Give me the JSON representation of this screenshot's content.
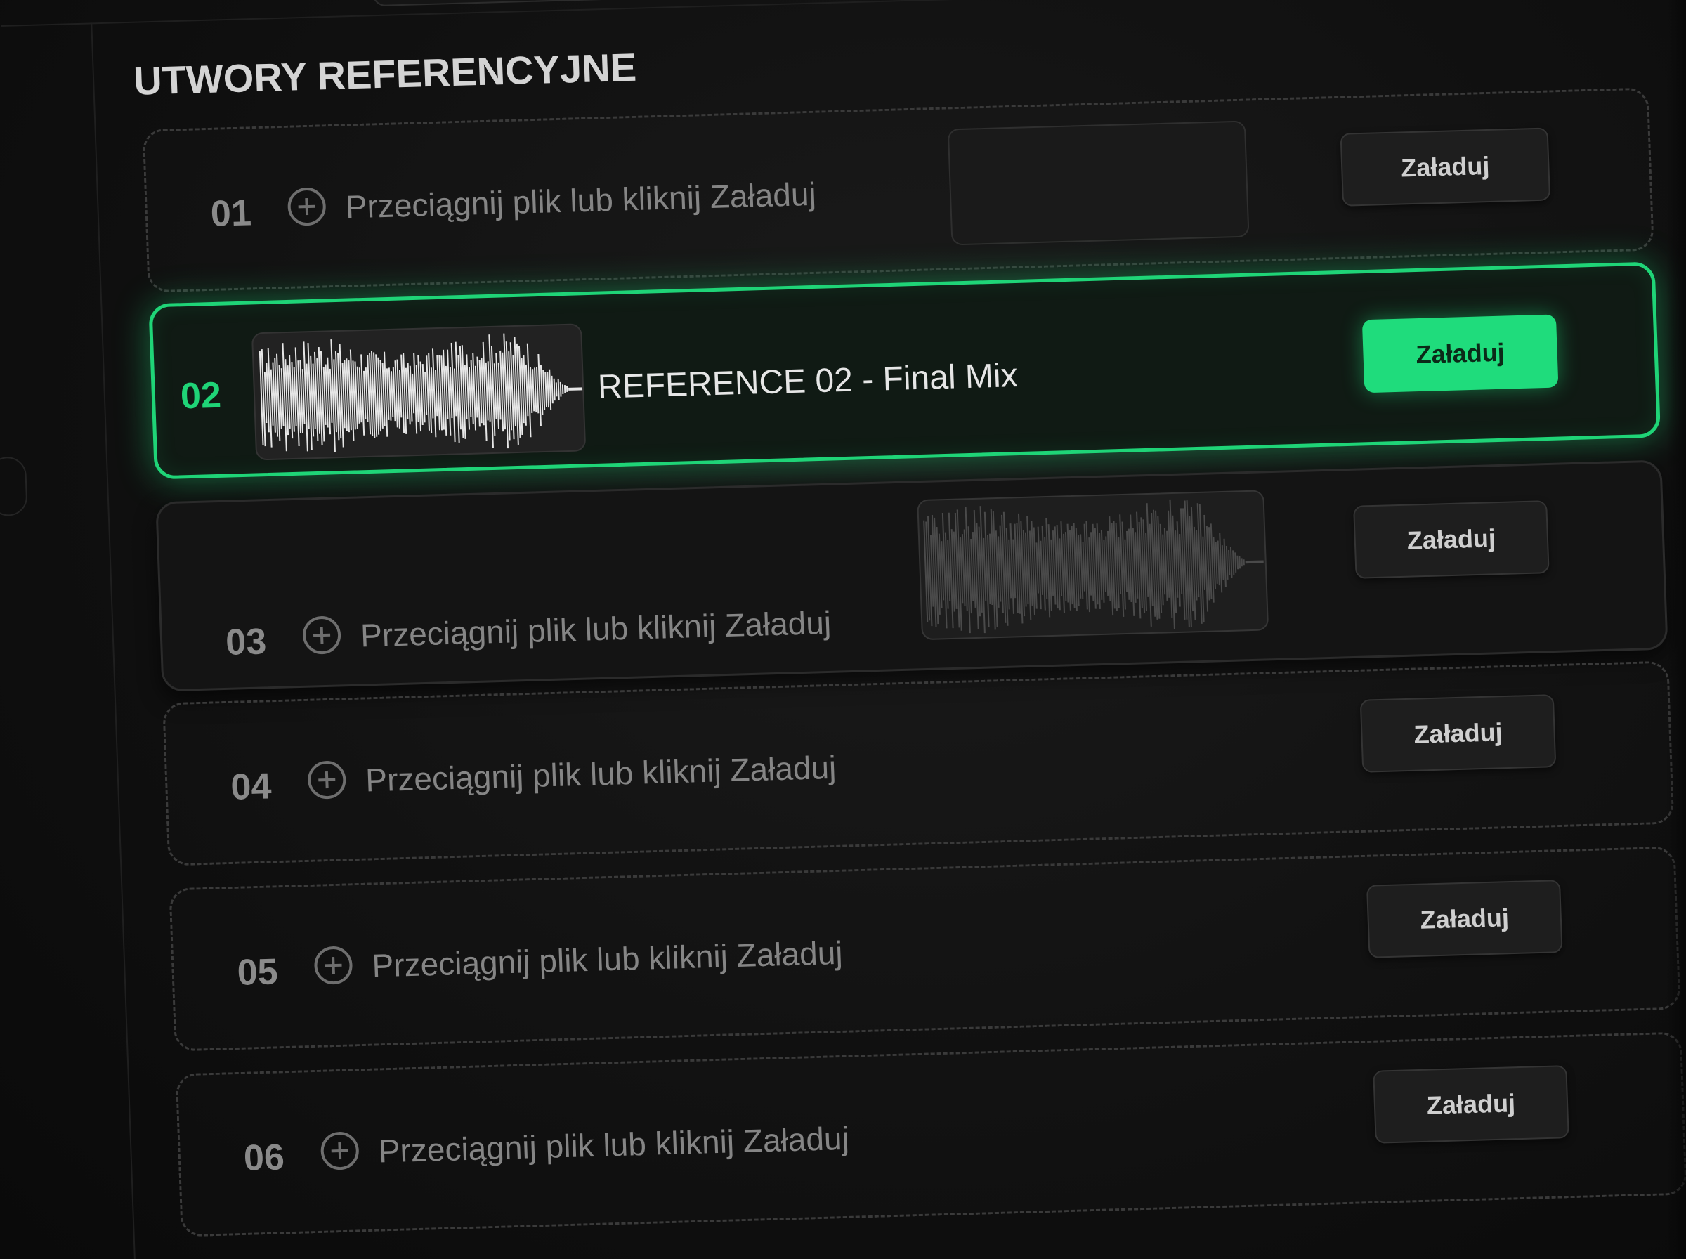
{
  "section": {
    "title": "UTWORY REFERENCYJNE"
  },
  "accent_color": "#1fd477",
  "tracks": [
    {
      "number": "01",
      "state": "empty",
      "hint": "Przeciągnij plik lub kliknij Załaduj",
      "button_label": "Załaduj"
    },
    {
      "number": "02",
      "state": "active",
      "title": "REFERENCE 02 - Final Mix",
      "button_label": "Załaduj"
    },
    {
      "number": "03",
      "state": "empty",
      "hint": "Przeciągnij plik lub kliknij Załaduj",
      "button_label": "Załaduj"
    },
    {
      "number": "04",
      "state": "empty",
      "hint": "Przeciągnij plik lub kliknij Załaduj",
      "button_label": "Załaduj"
    },
    {
      "number": "05",
      "state": "empty",
      "hint": "Przeciągnij plik lub kliknij Załaduj",
      "button_label": "Załaduj"
    },
    {
      "number": "06",
      "state": "empty",
      "hint": "Przeciągnij plik lub kliknij Załaduj",
      "button_label": "Załaduj"
    }
  ],
  "icons": {
    "add": "plus-circle-icon",
    "waveform": "waveform-icon"
  }
}
